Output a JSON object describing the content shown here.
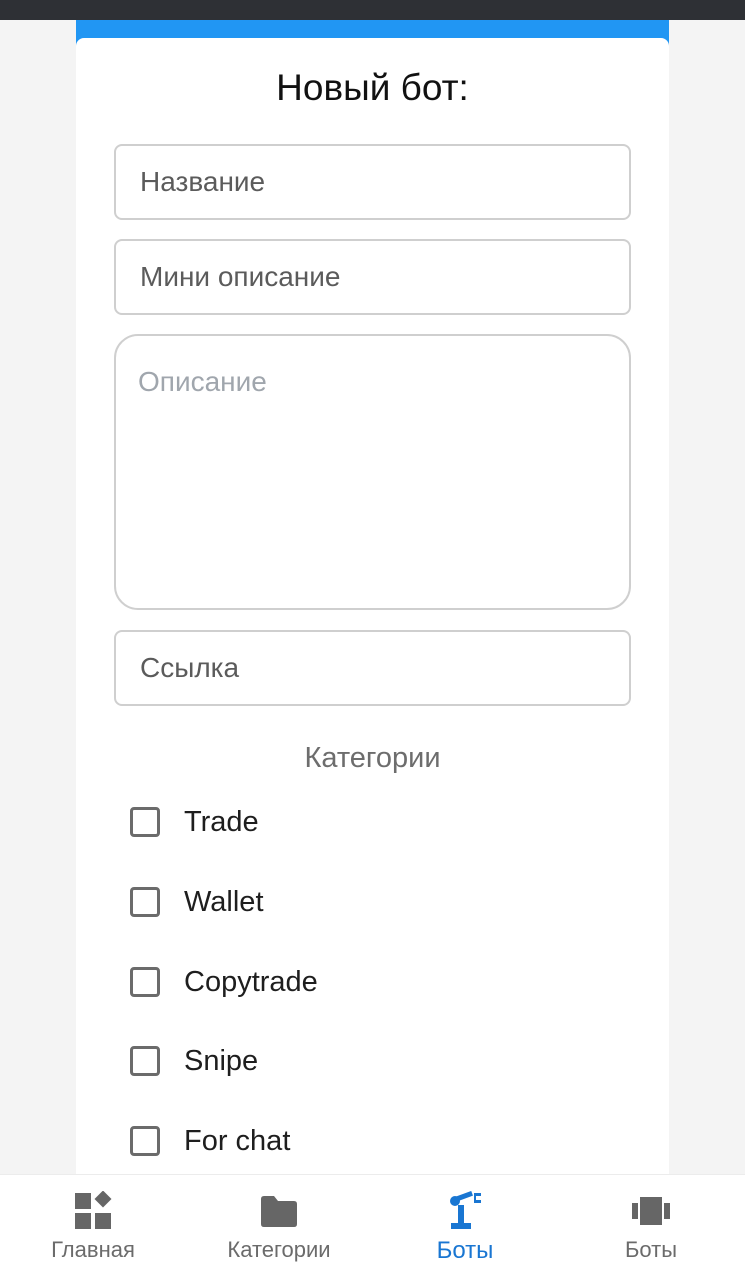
{
  "form": {
    "title": "Новый бот:",
    "name_placeholder": "Название",
    "mini_description_placeholder": "Мини описание",
    "description_placeholder": "Описание",
    "link_placeholder": "Ссылка"
  },
  "categories": {
    "title": "Категории",
    "items": [
      {
        "label": "Trade",
        "checked": false
      },
      {
        "label": "Wallet",
        "checked": false
      },
      {
        "label": "Copytrade",
        "checked": false
      },
      {
        "label": "Snipe",
        "checked": false
      },
      {
        "label": "For chat",
        "checked": false
      }
    ]
  },
  "bottom_nav": {
    "items": [
      {
        "label": "Главная",
        "icon": "dashboard-icon",
        "active": false
      },
      {
        "label": "Категории",
        "icon": "folder-icon",
        "active": false
      },
      {
        "label": "Боты",
        "icon": "robot-arm-icon",
        "active": true
      },
      {
        "label": "Боты",
        "icon": "carousel-icon",
        "active": false
      }
    ]
  },
  "colors": {
    "accent": "#2196f3",
    "active_nav": "#1976d2",
    "status_bar": "#2e3035"
  }
}
